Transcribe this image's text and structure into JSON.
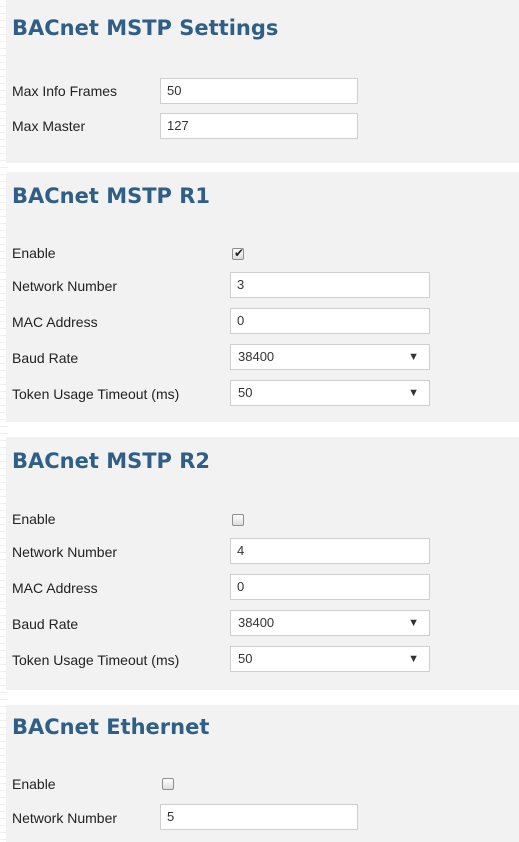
{
  "mstp_settings": {
    "title": "BACnet MSTP Settings",
    "max_info_frames": {
      "label": "Max Info Frames",
      "value": "50"
    },
    "max_master": {
      "label": "Max Master",
      "value": "127"
    }
  },
  "mstp_r1": {
    "title": "BACnet MSTP R1",
    "enable": {
      "label": "Enable",
      "checked": true,
      "check_glyph": "✔"
    },
    "network_number": {
      "label": "Network Number",
      "value": "3"
    },
    "mac_address": {
      "label": "MAC Address",
      "value": "0"
    },
    "baud_rate": {
      "label": "Baud Rate",
      "value": "38400"
    },
    "token_timeout": {
      "label": "Token Usage Timeout (ms)",
      "value": "50"
    }
  },
  "mstp_r2": {
    "title": "BACnet MSTP R2",
    "enable": {
      "label": "Enable",
      "checked": false
    },
    "network_number": {
      "label": "Network Number",
      "value": "4"
    },
    "mac_address": {
      "label": "MAC Address",
      "value": "0"
    },
    "baud_rate": {
      "label": "Baud Rate",
      "value": "38400"
    },
    "token_timeout": {
      "label": "Token Usage Timeout (ms)",
      "value": "50"
    }
  },
  "ethernet": {
    "title": "BACnet Ethernet",
    "enable": {
      "label": "Enable",
      "checked": false
    },
    "network_number": {
      "label": "Network Number",
      "value": "5"
    }
  },
  "icons": {
    "dropdown": "▼"
  },
  "colors": {
    "title": "#2f5f86",
    "panel_bg": "#f2f2f2"
  }
}
